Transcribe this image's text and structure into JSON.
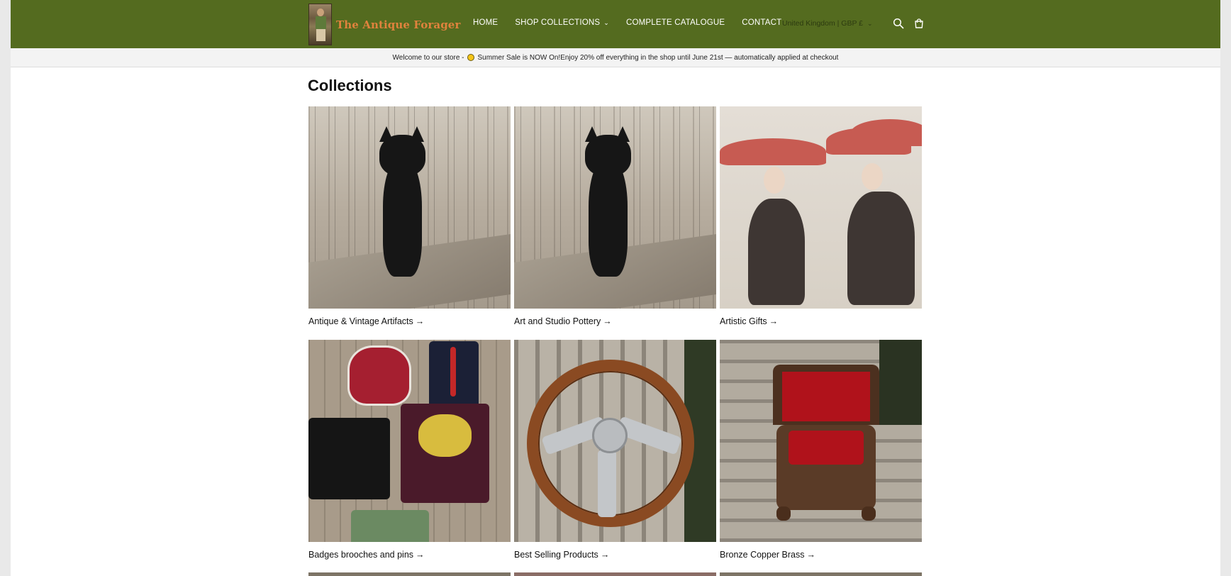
{
  "store": {
    "name": "The Antique Forager",
    "logo_alt": "logo-image"
  },
  "nav": {
    "items": [
      {
        "label": "HOME",
        "has_dropdown": false
      },
      {
        "label": "SHOP COLLECTIONS",
        "has_dropdown": true
      },
      {
        "label": "COMPLETE CATALOGUE",
        "has_dropdown": false
      },
      {
        "label": "CONTACT",
        "has_dropdown": false
      }
    ],
    "locale": "United Kingdom | GBP £",
    "icons": [
      "search-icon",
      "cart-icon"
    ]
  },
  "announcement": {
    "prefix": "Welcome to our store -",
    "icon": "sun-icon",
    "text": "Summer Sale is NOW On!Enjoy 20% off everything in the shop until June 21st — automatically applied at checkout"
  },
  "page": {
    "title": "Collections"
  },
  "collections": [
    {
      "label": "Antique & Vintage Artifacts",
      "arrow": "→"
    },
    {
      "label": "Art and Studio Pottery",
      "arrow": "→"
    },
    {
      "label": "Artistic Gifts",
      "arrow": "→"
    },
    {
      "label": "Badges brooches and pins",
      "arrow": "→"
    },
    {
      "label": "Best Selling Products",
      "arrow": "→"
    },
    {
      "label": "Bronze Copper Brass",
      "arrow": "→"
    }
  ],
  "colors": {
    "header_bg": "#546b1f",
    "logo_text": "#e0823d",
    "announcement_bg": "#f3f3f3",
    "page_bg": "#ffffff"
  }
}
